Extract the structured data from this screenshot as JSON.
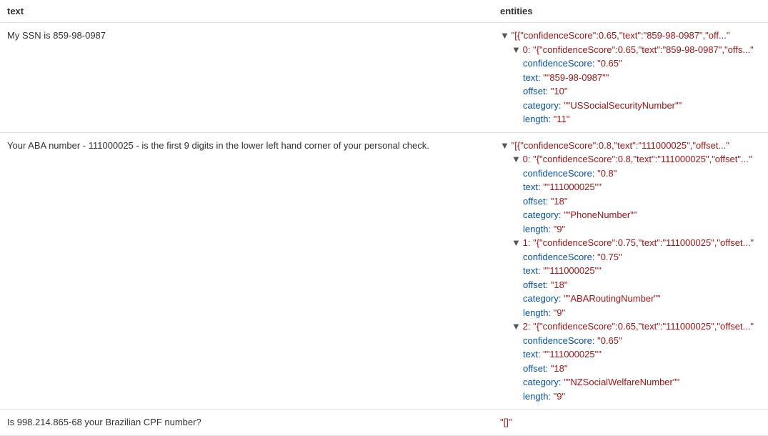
{
  "headers": {
    "text": "text",
    "entities": "entities"
  },
  "rows": [
    {
      "text": "My SSN is 859-98-0987",
      "root": "\"[{\"confidenceScore\":0.65,\"text\":\"859-98-0987\",\"off...\"",
      "items": [
        {
          "summary": "\"{\"confidenceScore\":0.65,\"text\":\"859-98-0987\",\"offs...\"",
          "props": [
            {
              "k": "confidenceScore",
              "v": "\"0.65\""
            },
            {
              "k": "text",
              "v": "\"\"859-98-0987\"\""
            },
            {
              "k": "offset",
              "v": "\"10\""
            },
            {
              "k": "category",
              "v": "\"\"USSocialSecurityNumber\"\""
            },
            {
              "k": "length",
              "v": "\"11\""
            }
          ]
        }
      ]
    },
    {
      "text": "Your ABA number - 111000025 - is the first 9 digits in the lower left hand corner of your personal check.",
      "root": "\"[{\"confidenceScore\":0.8,\"text\":\"111000025\",\"offset...\"",
      "items": [
        {
          "summary": "\"{\"confidenceScore\":0.8,\"text\":\"111000025\",\"offset\"...\"",
          "props": [
            {
              "k": "confidenceScore",
              "v": "\"0.8\""
            },
            {
              "k": "text",
              "v": "\"\"111000025\"\""
            },
            {
              "k": "offset",
              "v": "\"18\""
            },
            {
              "k": "category",
              "v": "\"\"PhoneNumber\"\""
            },
            {
              "k": "length",
              "v": "\"9\""
            }
          ]
        },
        {
          "summary": "\"{\"confidenceScore\":0.75,\"text\":\"111000025\",\"offset...\"",
          "props": [
            {
              "k": "confidenceScore",
              "v": "\"0.75\""
            },
            {
              "k": "text",
              "v": "\"\"111000025\"\""
            },
            {
              "k": "offset",
              "v": "\"18\""
            },
            {
              "k": "category",
              "v": "\"\"ABARoutingNumber\"\""
            },
            {
              "k": "length",
              "v": "\"9\""
            }
          ]
        },
        {
          "summary": "\"{\"confidenceScore\":0.65,\"text\":\"111000025\",\"offset...\"",
          "props": [
            {
              "k": "confidenceScore",
              "v": "\"0.65\""
            },
            {
              "k": "text",
              "v": "\"\"111000025\"\""
            },
            {
              "k": "offset",
              "v": "\"18\""
            },
            {
              "k": "category",
              "v": "\"\"NZSocialWelfareNumber\"\""
            },
            {
              "k": "length",
              "v": "\"9\""
            }
          ]
        }
      ]
    },
    {
      "text": "Is 998.214.865-68 your Brazilian CPF number?",
      "root": "\"[]\"",
      "items": []
    }
  ]
}
